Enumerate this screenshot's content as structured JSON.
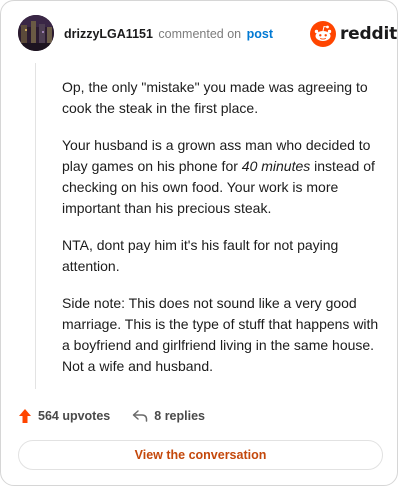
{
  "header": {
    "username": "drizzyLGA1151",
    "commented_on": "commented on",
    "post_link": "post",
    "logo_text": "reddit"
  },
  "comment": {
    "paragraphs": [
      {
        "text": "Op, the only \"mistake\" you made was agreeing to cook the steak in the first place."
      },
      {
        "before": "Your husband is a grown ass man who decided to play games on his phone for ",
        "emphasis": "40 minutes",
        "after": " instead of checking on his own food. Your work is more important than his precious steak."
      },
      {
        "text": "NTA, dont pay him it's his fault for not paying attention."
      },
      {
        "text": "Side note: This does not sound like a very good marriage. This is the type of stuff that happens with a boyfriend and girlfriend living in the same house. Not a wife and husband."
      }
    ]
  },
  "actions": {
    "upvotes": "564 upvotes",
    "replies": "8 replies",
    "upvote_icon": "upvote-arrow-icon",
    "reply_icon": "reply-arrow-icon"
  },
  "cta": {
    "label": "View the conversation"
  },
  "colors": {
    "upvote": "#ff4500",
    "link": "#0079d3",
    "cta_text": "#c4480b",
    "logo": "#ff4500"
  }
}
